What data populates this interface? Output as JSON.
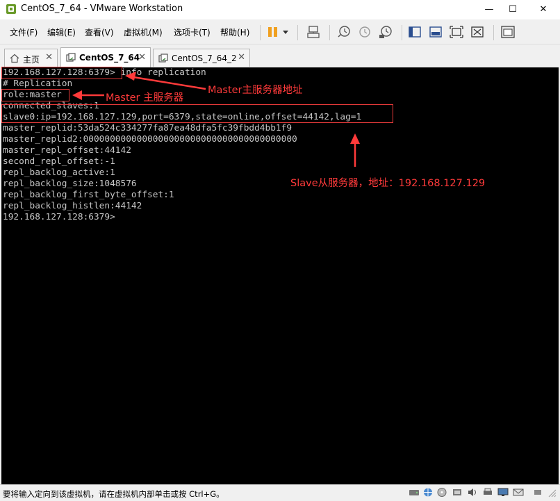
{
  "window": {
    "title": "CentOS_7_64 - VMware Workstation",
    "minimize_glyph": "—",
    "maximize_glyph": "☐",
    "close_glyph": "✕"
  },
  "menu": [
    "文件(F)",
    "编辑(E)",
    "查看(V)",
    "虚拟机(M)",
    "选项卡(T)",
    "帮助(H)"
  ],
  "toolbar_icons": [
    "pause-icon",
    "dropdown-arrow-icon",
    "send-keys-icon",
    "snapshot-icon",
    "revert-snapshot-icon",
    "snapshot-manager-icon",
    "sidebar-icon",
    "console-view-icon",
    "fullscreen-icon",
    "unity-icon",
    "thumbnail-icon"
  ],
  "tabs": [
    {
      "label": "主页",
      "icon": "home-icon",
      "close": "✕"
    },
    {
      "label": "CentOS_7_64",
      "icon": "vm-icon",
      "close": "✕",
      "active": true
    },
    {
      "label": "CentOS_7_64_2",
      "icon": "vm-icon",
      "close": "✕"
    }
  ],
  "terminal": [
    "192.168.127.128:6379> info replication",
    "# Replication",
    "role:master",
    "connected_slaves:1",
    "slave0:ip=192.168.127.129,port=6379,state=online,offset=44142,lag=1",
    "master_replid:53da524c334277fa87ea48dfa5fc39fbdd4bb1f9",
    "master_replid2:0000000000000000000000000000000000000000",
    "master_repl_offset:44142",
    "second_repl_offset:-1",
    "repl_backlog_active:1",
    "repl_backlog_size:1048576",
    "repl_backlog_first_byte_offset:1",
    "repl_backlog_histlen:44142",
    "192.168.127.128:6379>"
  ],
  "annotations": {
    "master_address": "Master主服务器地址",
    "master_role": "Master 主服务器",
    "slave_info": "Slave从服务器，地址：192.168.127.129"
  },
  "colors": {
    "annotation": "#ff3a3a",
    "terminal_bg": "#000000",
    "terminal_fg": "#c6c6c6",
    "pause_orange": "#f0a020"
  },
  "status": {
    "text": "要将输入定向到该虚拟机，请在虚拟机内部单击或按 Ctrl+G。"
  },
  "status_icons": [
    "hdd-icon",
    "network-icon",
    "cdrom-icon",
    "usb-icon",
    "sound-icon",
    "printer-icon",
    "display-icon",
    "message-icon"
  ]
}
